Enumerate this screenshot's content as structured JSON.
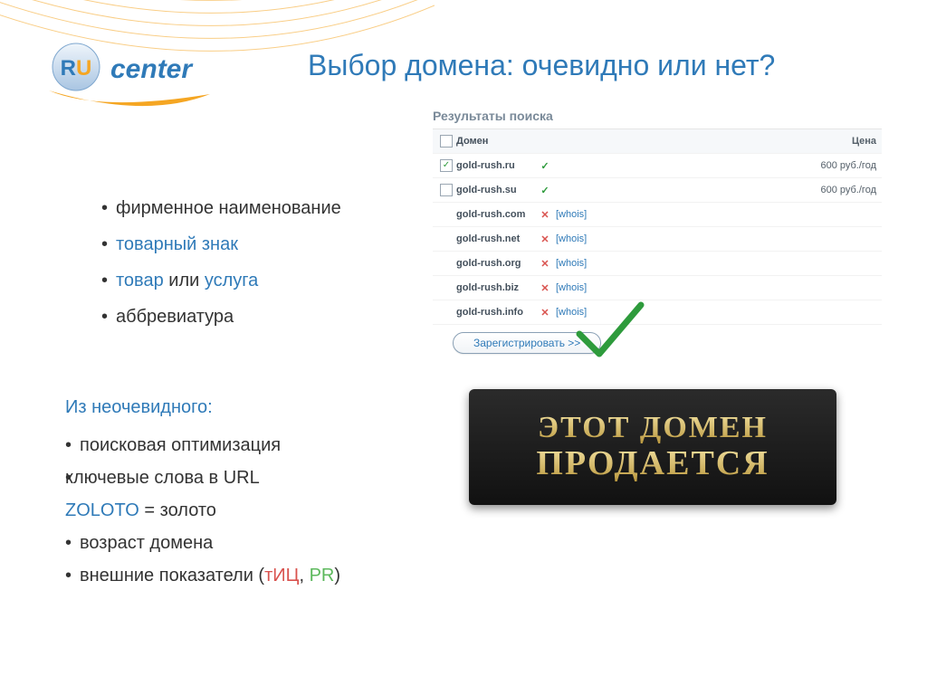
{
  "logo": {
    "ru": "RU",
    "center": "center"
  },
  "title": "Выбор домена: очевидно или нет?",
  "bullets1": {
    "b1": "фирменное наименование",
    "b2": "товарный знак",
    "b3_pre": "товар",
    "b3_mid": " или ",
    "b3_post": "услуга",
    "b4": "аббревиатура"
  },
  "block2": {
    "subhead": "Из неочевидного:",
    "l1": "поисковая оптимизация",
    "l2": "ключевые слова в URL",
    "zoloto_lat": "ZOLOTO",
    "zoloto_eq": " = золото",
    "l3": "возраст домена",
    "l4_pre": "внешние показатели (",
    "l4_tic": "тИЦ",
    "l4_sep": ", ",
    "l4_pr": "PR",
    "l4_post": ")"
  },
  "search": {
    "title": "Результаты поиска",
    "hdr_domain": "Домен",
    "hdr_price": "Цена",
    "whois_label": "[whois]",
    "rows": [
      {
        "domain": "gold-rush.ru",
        "checked": true,
        "ok": true,
        "whois": false,
        "price": "600 руб./год"
      },
      {
        "domain": "gold-rush.su",
        "checked": false,
        "ok": true,
        "whois": false,
        "price": "600 руб./год"
      },
      {
        "domain": "gold-rush.com",
        "checked": false,
        "ok": false,
        "whois": true,
        "price": ""
      },
      {
        "domain": "gold-rush.net",
        "checked": false,
        "ok": false,
        "whois": true,
        "price": ""
      },
      {
        "domain": "gold-rush.org",
        "checked": false,
        "ok": false,
        "whois": true,
        "price": ""
      },
      {
        "domain": "gold-rush.biz",
        "checked": false,
        "ok": false,
        "whois": true,
        "price": ""
      },
      {
        "domain": "gold-rush.info",
        "checked": false,
        "ok": false,
        "whois": true,
        "price": ""
      }
    ],
    "register": "Зарегистрировать >>"
  },
  "forsale": {
    "line1": "ЭТОТ ДОМЕН",
    "line2": "ПРОДАЕТСЯ"
  }
}
